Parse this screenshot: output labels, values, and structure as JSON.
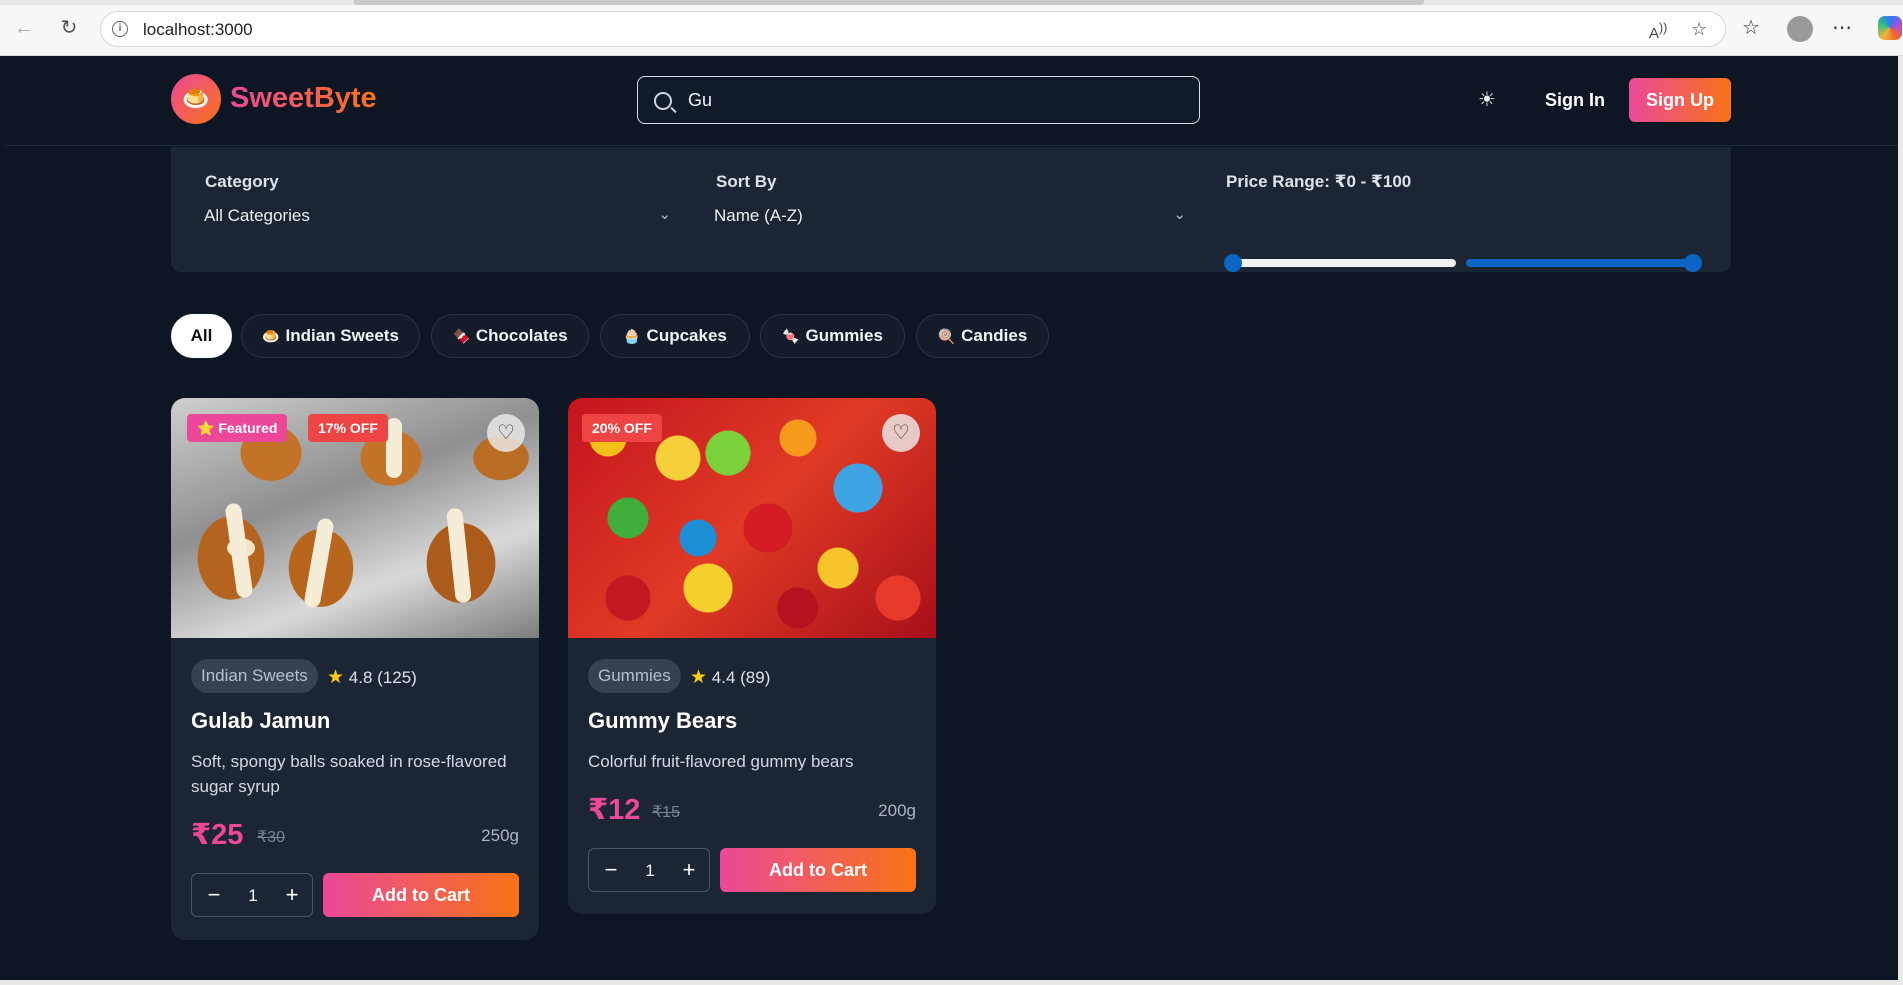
{
  "browser": {
    "url": "localhost:3000"
  },
  "header": {
    "logo_emoji": "🍮",
    "brand": "SweetByte",
    "search_value": "Gu",
    "sign_in": "Sign In",
    "sign_up": "Sign Up",
    "accent_from": "#ec4899",
    "accent_to": "#f97316"
  },
  "filters": {
    "category_label": "Category",
    "category_value": "All Categories",
    "sort_label": "Sort By",
    "sort_value": "Name (A-Z)",
    "price_label": "Price Range: ₹0 - ₹100",
    "price_min": 0,
    "price_max": 100
  },
  "chips": [
    {
      "label": "All",
      "emoji": ""
    },
    {
      "label": "Indian Sweets",
      "emoji": "🍮"
    },
    {
      "label": "Chocolates",
      "emoji": "🍫"
    },
    {
      "label": "Cupcakes",
      "emoji": "🧁"
    },
    {
      "label": "Gummies",
      "emoji": "🍬"
    },
    {
      "label": "Candies",
      "emoji": "🍭"
    }
  ],
  "products": [
    {
      "featured": "⭐ Featured",
      "discount": "17% OFF",
      "category": "Indian Sweets",
      "rating": "4.8 (125)",
      "name": "Gulab Jamun",
      "description": "Soft, spongy balls soaked in rose-flavored sugar syrup",
      "price": "₹25",
      "old_price": "₹30",
      "weight": "250g",
      "quantity": "1",
      "add_label": "Add to Cart"
    },
    {
      "discount": "20% OFF",
      "category": "Gummies",
      "rating": "4.4 (89)",
      "name": "Gummy Bears",
      "description": "Colorful fruit-flavored gummy bears",
      "price": "₹12",
      "old_price": "₹15",
      "weight": "200g",
      "quantity": "1",
      "add_label": "Add to Cart"
    }
  ]
}
